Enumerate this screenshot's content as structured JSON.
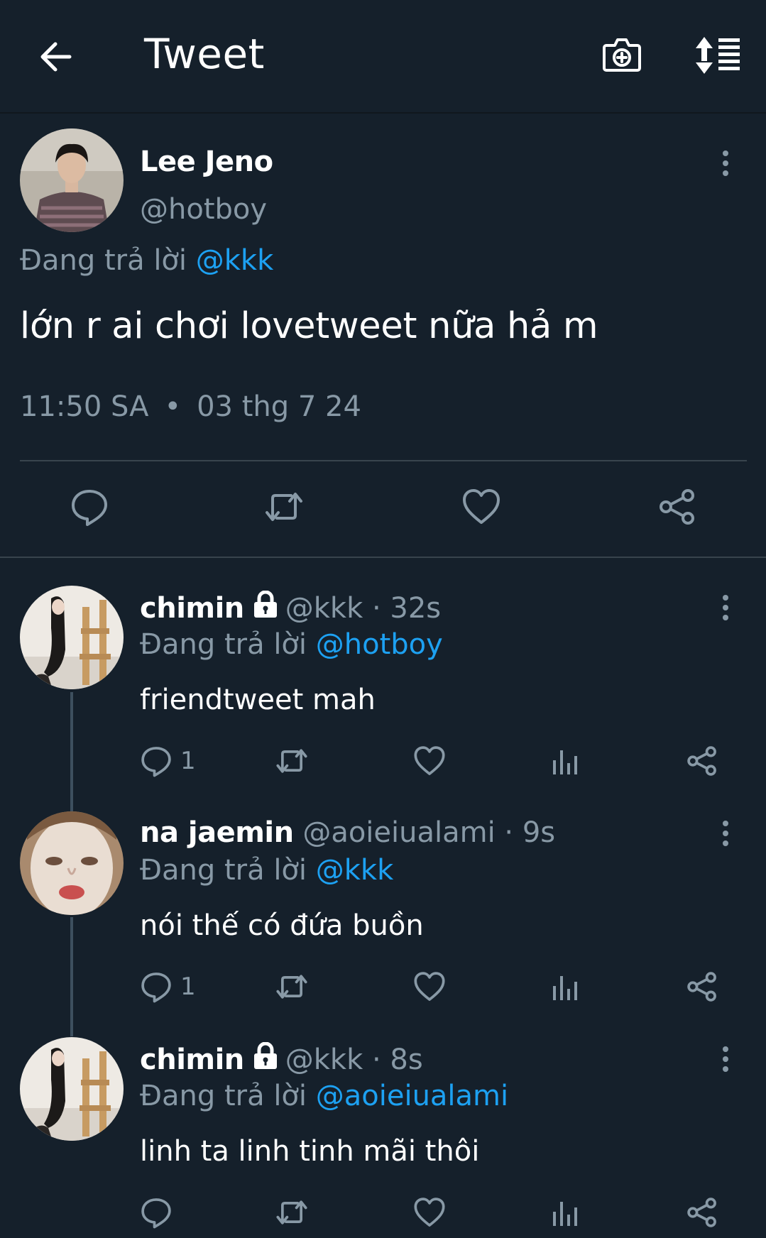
{
  "header": {
    "title": "Tweet",
    "icons": [
      "back-arrow-icon",
      "camera-plus-icon",
      "sort-list-icon"
    ]
  },
  "tweet": {
    "author_name": "Lee Jeno",
    "author_handle": "@hotboy",
    "reply_prefix": "Đang trả lời",
    "reply_to": "@kkk",
    "text": "lớn r ai chơi lovetweet nữa hả m",
    "time": "11:50 SA",
    "separator": "•",
    "date": "03 thg 7 24"
  },
  "replies": [
    {
      "name": "chimin",
      "handle_time": "@kkk · 32s",
      "reply_prefix": "Đang trả lời",
      "reply_to": "@hotboy",
      "text": "friendtweet mah",
      "reply_count": "1"
    },
    {
      "name": "na jaemin",
      "handle_time": "@aoieiualami · 9s",
      "reply_prefix": "Đang trả lời",
      "reply_to": "@kkk",
      "text": "nói thế có đứa buồn",
      "reply_count": "1"
    },
    {
      "name": "chimin",
      "handle_time": "@kkk · 8s",
      "reply_prefix": "Đang trả lời",
      "reply_to": "@aoieiualami",
      "text": "linh ta linh tinh mãi thôi",
      "reply_count": ""
    }
  ],
  "colors": {
    "background": "#15202b",
    "accent": "#1da1f2",
    "secondary_text": "#8899a6",
    "divider": "#38444d"
  }
}
